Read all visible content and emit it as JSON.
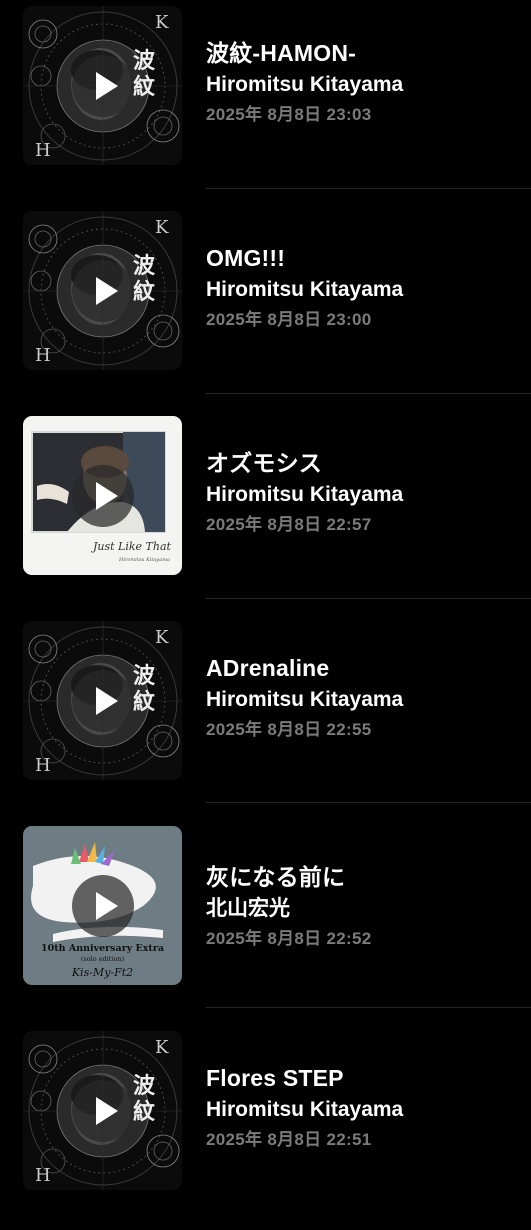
{
  "tracks": [
    {
      "title": "波紋-HAMON-",
      "artist": "Hiromitsu Kitayama",
      "date": "2025年 8月8日 23:03",
      "cover": "hamon"
    },
    {
      "title": "OMG!!!",
      "artist": "Hiromitsu Kitayama",
      "date": "2025年 8月8日 23:00",
      "cover": "hamon"
    },
    {
      "title": "オズモシス",
      "artist": "Hiromitsu Kitayama",
      "date": "2025年 8月8日 22:57",
      "cover": "just_like_that"
    },
    {
      "title": "ADrenaline",
      "artist": "Hiromitsu Kitayama",
      "date": "2025年 8月8日 22:55",
      "cover": "hamon"
    },
    {
      "title": "灰になる前に",
      "artist": "北山宏光",
      "date": "2025年 8月8日 22:52",
      "cover": "kismyft2"
    },
    {
      "title": "Flores STEP",
      "artist": "Hiromitsu Kitayama",
      "date": "2025年 8月8日 22:51",
      "cover": "hamon"
    }
  ],
  "covers": {
    "hamon": {
      "kanji_top": "波",
      "kanji_bottom": "紋",
      "letter_k": "K",
      "letter_h": "H"
    },
    "just_like_that": {
      "script": "Just Like That",
      "signature": "Hiromitsu Kitayama"
    },
    "kismyft2": {
      "line1": "10th Anniversary Extra",
      "line2": "(solo edition)",
      "band": "Kis-My-Ft2"
    }
  },
  "colors": {
    "background": "#000000",
    "primary_text": "#ffffff",
    "secondary_text": "#7b7b7b",
    "separator": "#262626",
    "kis_cover_bg": "#6e7c84"
  },
  "icons": {
    "play": "play-icon"
  }
}
